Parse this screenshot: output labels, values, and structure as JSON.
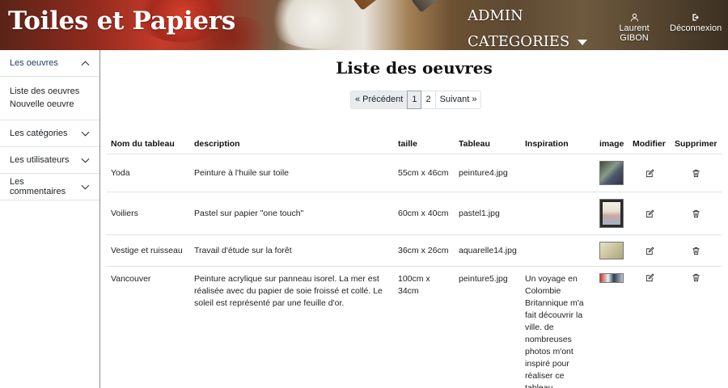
{
  "header": {
    "brand": "Toiles et Papiers",
    "admin_line1": "ADMIN",
    "admin_line2": "CATEGORIES",
    "user_name": "Laurent GIBON",
    "logout_label": "Déconnexion"
  },
  "sidebar": {
    "oeuvres_label": "Les oeuvres",
    "sub_items": [
      "Liste des oeuvres",
      "Nouvelle oeuvre"
    ],
    "categories_label": "Les catégories",
    "users_label": "Les utilisateurs",
    "comments_label": "Les commentaires"
  },
  "main": {
    "title": "Liste des oeuvres",
    "pagination": {
      "prev": "« Précédent",
      "pages": [
        "1",
        "2"
      ],
      "next": "Suivant »"
    },
    "table": {
      "headers": [
        "Nom du tableau",
        "description",
        "taille",
        "Tableau",
        "Inspiration",
        "image",
        "Modifier",
        "Supprimer"
      ],
      "rows": [
        {
          "name": "Yoda",
          "description": "Peinture à l'huile sur toile",
          "size": "55cm x 46cm",
          "file": "peinture4.jpg",
          "inspiration": ""
        },
        {
          "name": "Voiliers",
          "description": "Pastel sur papier \"one touch\"",
          "size": "60cm x 40cm",
          "file": "pastel1.jpg",
          "inspiration": ""
        },
        {
          "name": "Vestige et ruisseau",
          "description": "Travail d'étude sur la forêt",
          "size": "36cm x 26cm",
          "file": "aquarelle14.jpg",
          "inspiration": ""
        },
        {
          "name": "Vancouver",
          "description": "Peinture acrylique sur panneau isorel. La mer est réalisée avec du papier de soie froissé et collé. Le soleil est représenté par une feuille d'or.",
          "size": "100cm x 34cm",
          "file": "peinture5.jpg",
          "inspiration": "Un voyage en Colombie Britannique m'a fait découvrir la ville. de nombreuses photos m'ont inspiré pour réaliser ce tableau"
        }
      ]
    }
  },
  "icons": {
    "user": "user-icon",
    "logout": "logout-icon",
    "chevron_up": "chevron-up-icon",
    "chevron_down": "chevron-down-icon",
    "edit": "edit-icon",
    "trash": "trash-icon"
  },
  "colors": {
    "accent_text": "#1f3d66",
    "border": "#dee2e6"
  }
}
